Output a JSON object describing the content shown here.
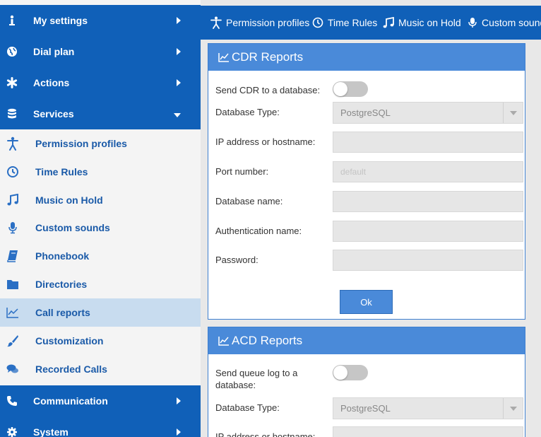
{
  "sidebar": {
    "top_items": [
      {
        "label": "My settings",
        "icon": "info-icon"
      },
      {
        "label": "Dial plan",
        "icon": "globe-icon"
      },
      {
        "label": "Actions",
        "icon": "asterisk-icon"
      },
      {
        "label": "Services",
        "icon": "database-icon",
        "expanded": true
      }
    ],
    "sub_items": [
      {
        "label": "Permission profiles",
        "icon": "accessibility-icon"
      },
      {
        "label": "Time Rules",
        "icon": "clock-icon"
      },
      {
        "label": "Music on Hold",
        "icon": "music-note-icon"
      },
      {
        "label": "Custom sounds",
        "icon": "microphone-icon"
      },
      {
        "label": "Phonebook",
        "icon": "book-icon"
      },
      {
        "label": "Directories",
        "icon": "folder-icon"
      },
      {
        "label": "Call reports",
        "icon": "chart-line-icon",
        "active": true
      },
      {
        "label": "Customization",
        "icon": "brush-icon"
      },
      {
        "label": "Recorded Calls",
        "icon": "chat-bubbles-icon"
      }
    ],
    "bottom_items": [
      {
        "label": "Communication",
        "icon": "phone-icon"
      },
      {
        "label": "System",
        "icon": "gear-icon"
      }
    ]
  },
  "topbar": {
    "items": [
      {
        "label": "Permission profiles",
        "icon": "accessibility-icon"
      },
      {
        "label": "Time Rules",
        "icon": "clock-icon"
      },
      {
        "label": "Music on Hold",
        "icon": "music-note-icon"
      },
      {
        "label": "Custom sounds",
        "icon": "microphone-icon"
      }
    ]
  },
  "cdr": {
    "title": "CDR Reports",
    "send_label": "Send CDR to a database:",
    "send_enabled": false,
    "db_type_label": "Database Type:",
    "db_type_value": "PostgreSQL",
    "ip_label": "IP address or hostname:",
    "ip_value": "",
    "port_label": "Port number:",
    "port_placeholder": "default",
    "dbname_label": "Database name:",
    "auth_label": "Authentication name:",
    "password_label": "Password:",
    "ok_label": "Ok"
  },
  "acd": {
    "title": "ACD Reports",
    "send_label": "Send queue log to a database:",
    "send_enabled": false,
    "db_type_label": "Database Type:",
    "db_type_value": "PostgreSQL",
    "ip_label": "IP address or hostname:"
  },
  "colors": {
    "primary": "#1060b8",
    "panel_header": "#4a8ad9",
    "active_item_bg": "#c8dcef",
    "sub_item_text": "#1a5aa8"
  }
}
